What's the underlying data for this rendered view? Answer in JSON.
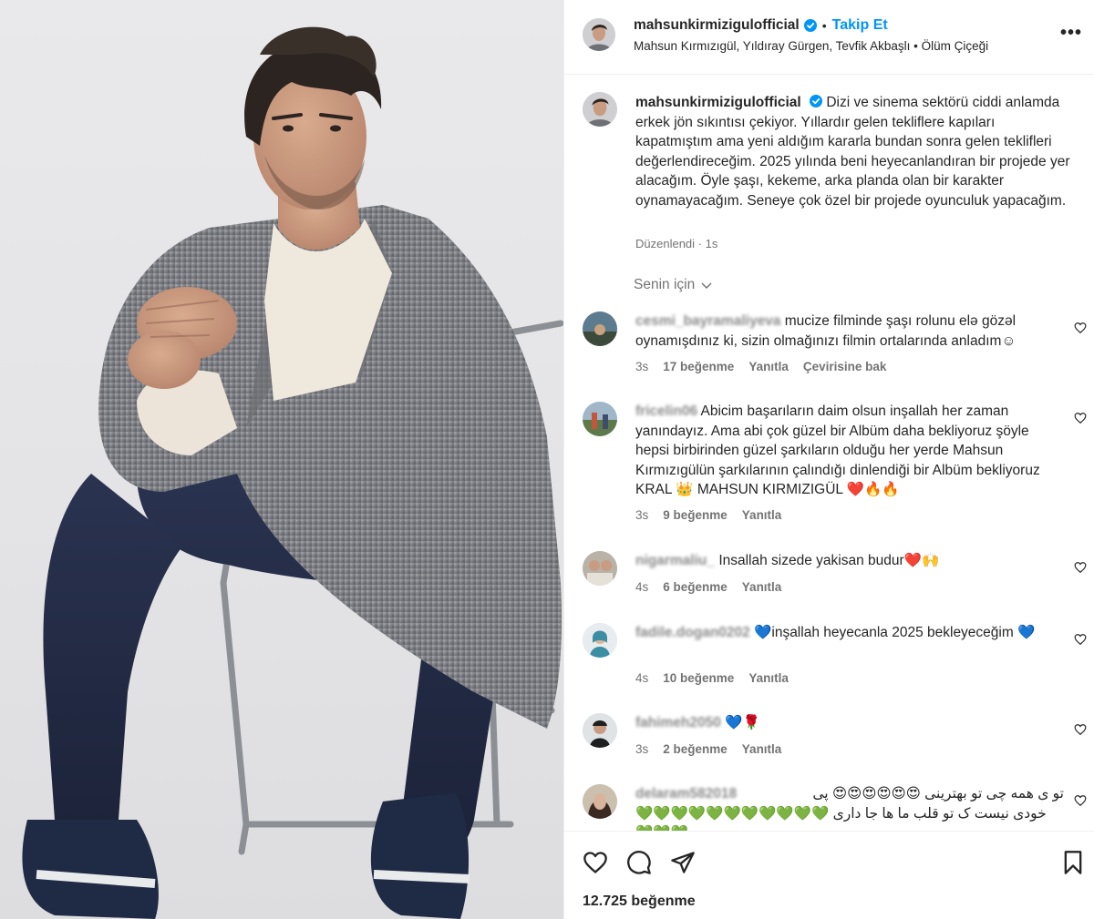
{
  "post": {
    "username": "mahsunkirmizigulofficial",
    "follow_label": "Takip Et",
    "tagged": "Mahsun Kırmızıgül, Yıldıray Gürgen, Tevfik Akbaşlı",
    "song": "Ölüm Çiçeği",
    "more_label": "•••",
    "caption": "Dizi ve sinema sektörü ciddi anlamda erkek jön sıkıntısı çekiyor. Yıllardır gelen tekliflere kapıları kapatmıştım ama yeni aldığım kararla bundan sonra gelen teklifleri değerlendireceğim. 2025 yılında beni heyecanlandıran bir projede yer alacağım. Öyle şaşı, kekeme, arka planda olan bir karakter oynamayacağım. Seneye çok özel bir projede oyunculuk yapacağım.",
    "edited": "Düzenlendi",
    "time": "1s",
    "sort_label": "Senin için",
    "likes": "12.725 beğenme"
  },
  "comments": [
    {
      "user": "cesmi_bayramaliyeva",
      "text": "mucize filminde şaşı rolunu elə gözəl oynamışdınız ki, sizin olmağınızı filmin ortalarında anladım☺",
      "time": "3s",
      "likes": "17 beğenme",
      "reply": "Yanıtla",
      "translate": "Çevirisine bak"
    },
    {
      "user": "fricelin06",
      "text": "Abicim başarıların daim olsun inşallah her zaman yanındayız. Ama abi çok güzel bir Albüm daha bekliyoruz şöyle hepsi birbirinden güzel şarkıların olduğu her yerde Mahsun Kırmızıgülün şarkılarının çalındığı dinlendiği bir Albüm bekliyoruz KRAL 👑 MAHSUN KIRMIZIGÜL ❤️🔥🔥",
      "time": "3s",
      "likes": "9 beğenme",
      "reply": "Yanıtla"
    },
    {
      "user": "nigarmaliu_",
      "text": "Insallah sizede yakisan budur❤️🙌",
      "time": "4s",
      "likes": "6 beğenme",
      "reply": "Yanıtla"
    },
    {
      "user": "fadile.dogan0202",
      "text": "💙inşallah heyecanla 2025 bekleyeceğim 💙",
      "time": "4s",
      "likes": "10 beğenme",
      "reply": "Yanıtla"
    },
    {
      "user": "fahimeh2050",
      "text": "💙🌹",
      "time": "3s",
      "likes": "2 beğenme",
      "reply": "Yanıtla"
    },
    {
      "user": "delaram582018",
      "text_line1": "تو ی همه چی تو بهترینی 😍😍😍😍😍😍 پی",
      "text_line2": "خودی نیست ک تو قلب ما ها جا داری 💚💚💚💚💚💚💚💚💚💚💚💚💚💚"
    }
  ],
  "colors": {
    "accent": "#0095f6",
    "text": "#262626",
    "secondary": "#737373"
  }
}
